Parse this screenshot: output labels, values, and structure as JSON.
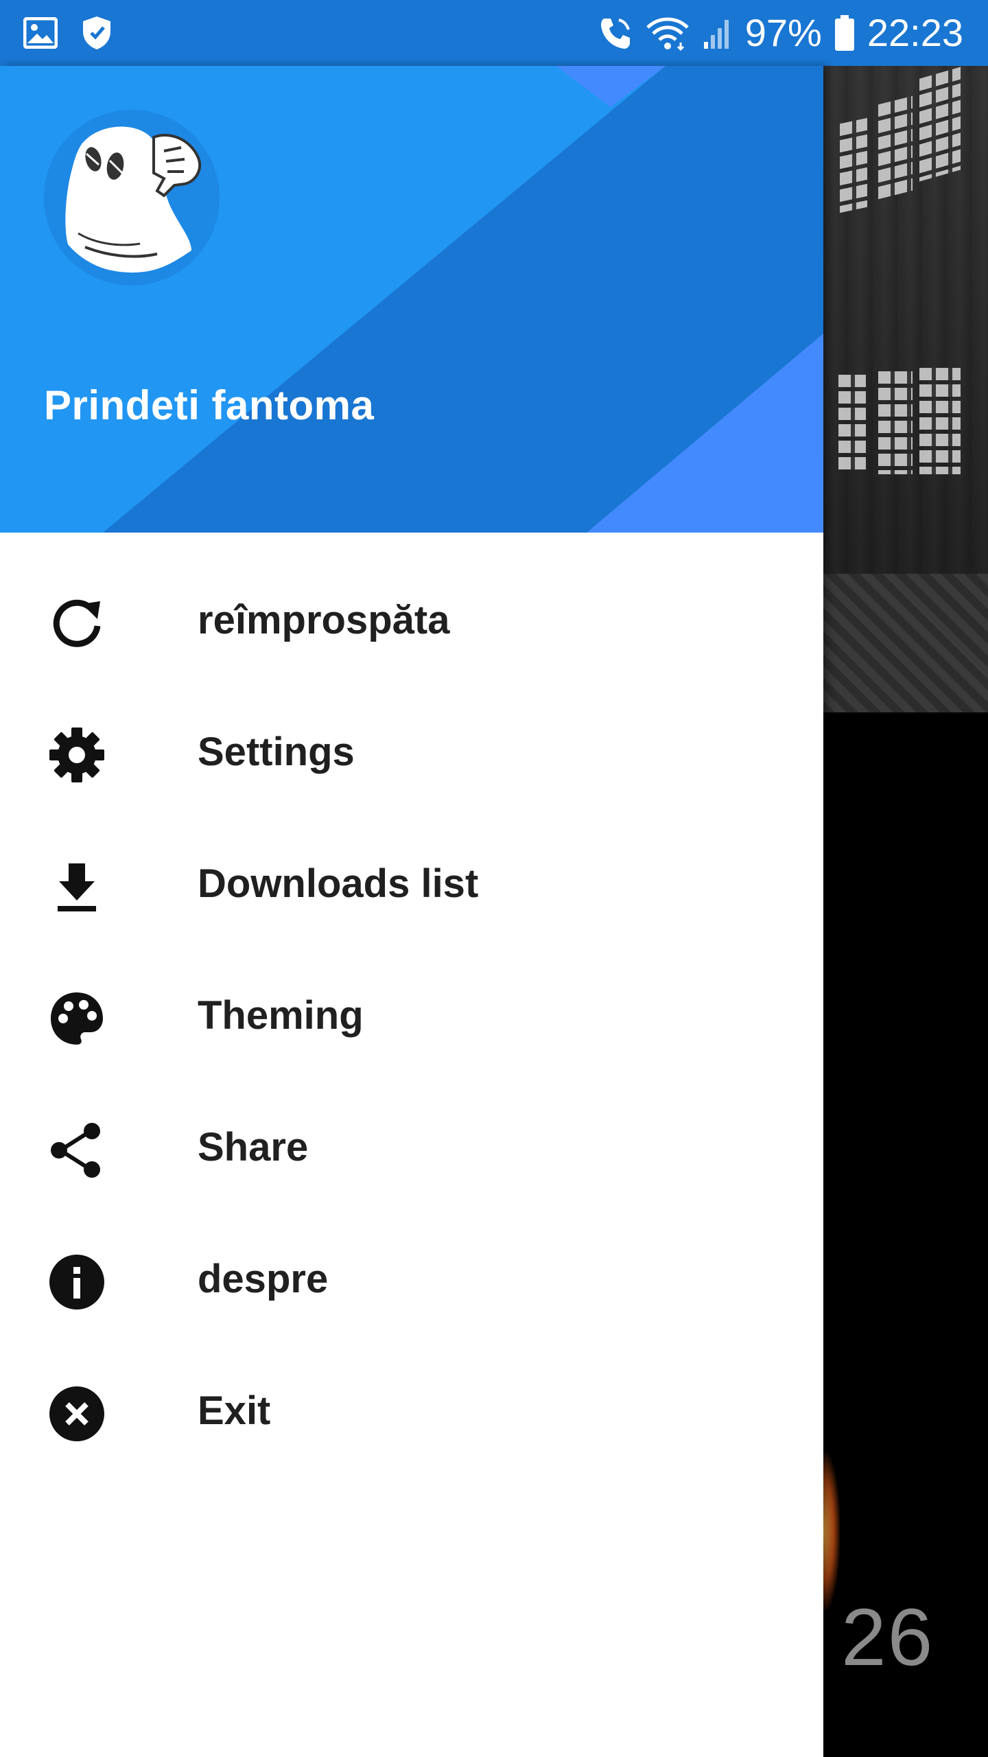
{
  "status_bar": {
    "battery": "97%",
    "time": "22:23",
    "icons": [
      "gallery-icon",
      "shield-icon",
      "wifi-calling-icon",
      "wifi-icon",
      "signal-icon",
      "battery-icon"
    ]
  },
  "drawer": {
    "title": "Prindeti fantoma",
    "avatar_icon": "ghost-icon",
    "items": [
      {
        "label": "reîmprospăta",
        "icon": "refresh-icon"
      },
      {
        "label": "Settings",
        "icon": "gear-icon"
      },
      {
        "label": "Downloads list",
        "icon": "download-icon"
      },
      {
        "label": "Theming",
        "icon": "palette-icon"
      },
      {
        "label": "Share",
        "icon": "share-icon"
      },
      {
        "label": "despre",
        "icon": "info-icon"
      },
      {
        "label": "Exit",
        "icon": "close-circle-icon"
      }
    ]
  },
  "background": {
    "number": "26"
  },
  "colors": {
    "status_bar": "#1976d2",
    "header_primary": "#2196f3",
    "header_dark": "#1976d2",
    "header_accent": "#448aff",
    "menu_text": "#202020"
  }
}
